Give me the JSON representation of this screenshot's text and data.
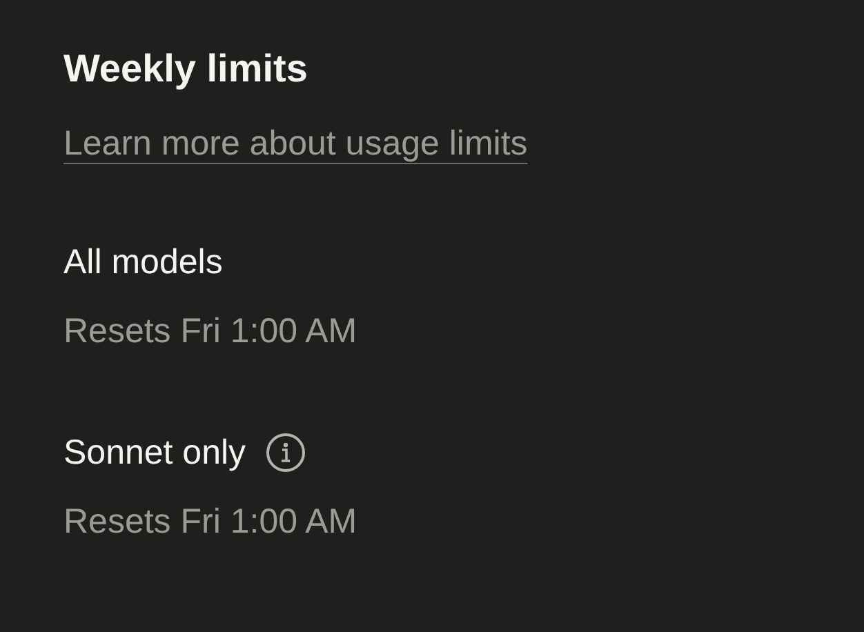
{
  "title": "Weekly limits",
  "link": "Learn more about usage limits",
  "limits": [
    {
      "label": "All models",
      "reset": "Resets Fri 1:00 AM",
      "info": false
    },
    {
      "label": "Sonnet only",
      "reset": "Resets Fri 1:00 AM",
      "info": true
    }
  ]
}
